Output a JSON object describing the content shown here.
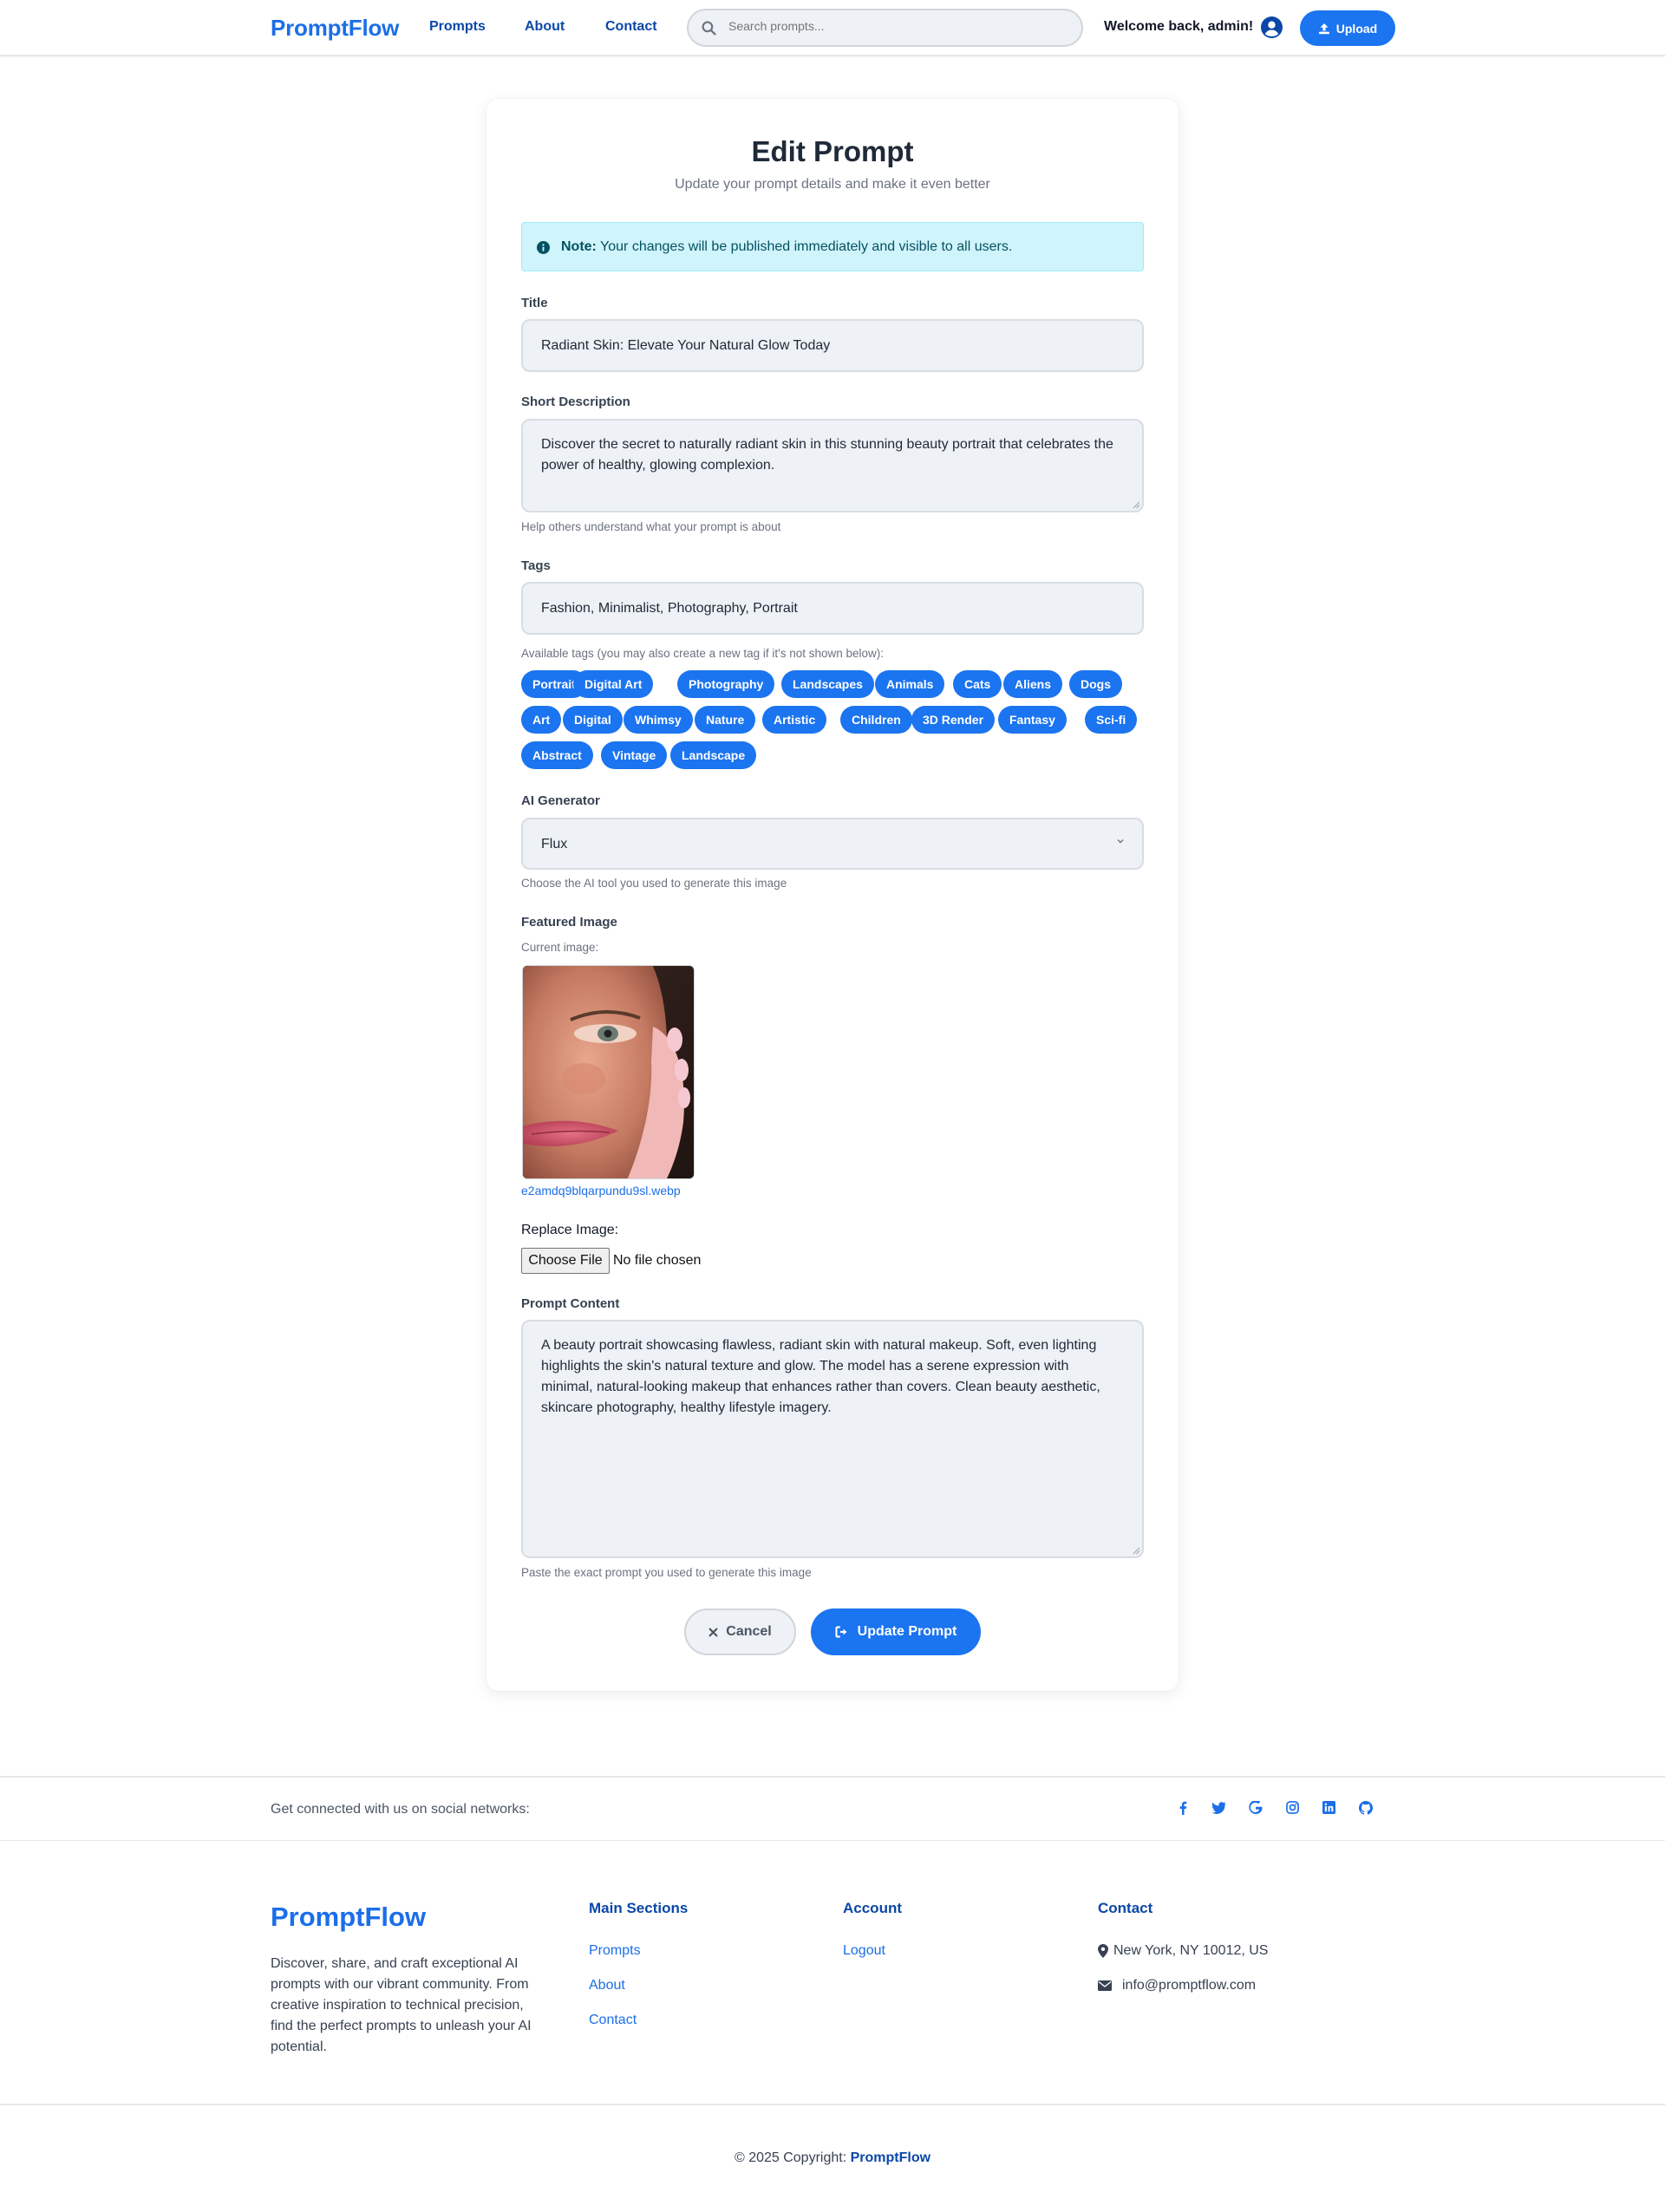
{
  "nav": {
    "brand": "PromptFlow",
    "links": [
      "Prompts",
      "About",
      "Contact"
    ],
    "search_placeholder": "Search prompts...",
    "welcome": "Welcome back, admin!",
    "upload_label": "Upload"
  },
  "form": {
    "heading": "Edit Prompt",
    "subtitle": "Update your prompt details and make it even better",
    "alert_strong": "Note:",
    "alert_text": " Your changes will be published immediately and visible to all users.",
    "title_label": "Title",
    "title_value": "Radiant Skin: Elevate Your Natural Glow Today",
    "desc_label": "Short Description",
    "desc_value": "Discover the secret to naturally radiant skin in this stunning beauty portrait that celebrates the power of healthy, glowing complexion.",
    "desc_help": "Help others understand what your prompt is about",
    "tags_label": "Tags",
    "tags_value": "Fashion, Minimalist, Photography, Portrait",
    "tags_help": "Available tags (you may also create a new tag if it's not shown below):",
    "available_tags": [
      "Portrait",
      "Digital Art",
      "Photography",
      "Landscapes",
      "Animals",
      "Cats",
      "Aliens",
      "Dogs",
      "Art",
      "Digital",
      "Whimsy",
      "Nature",
      "Artistic",
      "Children",
      "3D Render",
      "Fantasy",
      "Sci-fi",
      "Abstract",
      "Vintage",
      "Landscape"
    ],
    "generator_label": "AI Generator",
    "generator_value": "Flux",
    "generator_help": "Choose the AI tool you used to generate this image",
    "image_label": "Featured Image",
    "current_image_label": "Current image:",
    "image_filename": "e2amdq9blqarpundu9sl.webp",
    "replace_label": "Replace Image:",
    "choose_file": "Choose File",
    "no_file": "No file chosen",
    "content_label": "Prompt Content",
    "content_value": "A beauty portrait showcasing flawless, radiant skin with natural makeup. Soft, even lighting highlights the skin's natural texture and glow. The model has a serene expression with minimal, natural-looking makeup that enhances rather than covers. Clean beauty aesthetic, skincare photography, healthy lifestyle imagery.",
    "content_help": "Paste the exact prompt you used to generate this image",
    "cancel_label": "Cancel",
    "update_label": "Update Prompt"
  },
  "footer": {
    "social_text": "Get connected with us on social networks:",
    "social_icons": [
      "facebook-icon",
      "twitter-icon",
      "google-icon",
      "instagram-icon",
      "linkedin-icon",
      "github-icon"
    ],
    "brand": "PromptFlow",
    "description": "Discover, share, and craft exceptional AI prompts with our vibrant community. From creative inspiration to technical precision, find the perfect prompts to unleash your AI potential.",
    "main_heading": "Main Sections",
    "main_links": [
      "Prompts",
      "About",
      "Contact"
    ],
    "account_heading": "Account",
    "account_links": [
      "Logout"
    ],
    "contact_heading": "Contact",
    "address": "New York, NY 10012, US",
    "email": "info@promptflow.com",
    "copyright_prefix": "© 2025 Copyright: ",
    "copyright_brand": "PromptFlow"
  },
  "colors": {
    "primary": "#1b74f0",
    "link": "#1b6ee8",
    "heading_blue": "#0b47a8",
    "alert_bg": "#cff4fc",
    "field_bg": "#eef1f5"
  }
}
